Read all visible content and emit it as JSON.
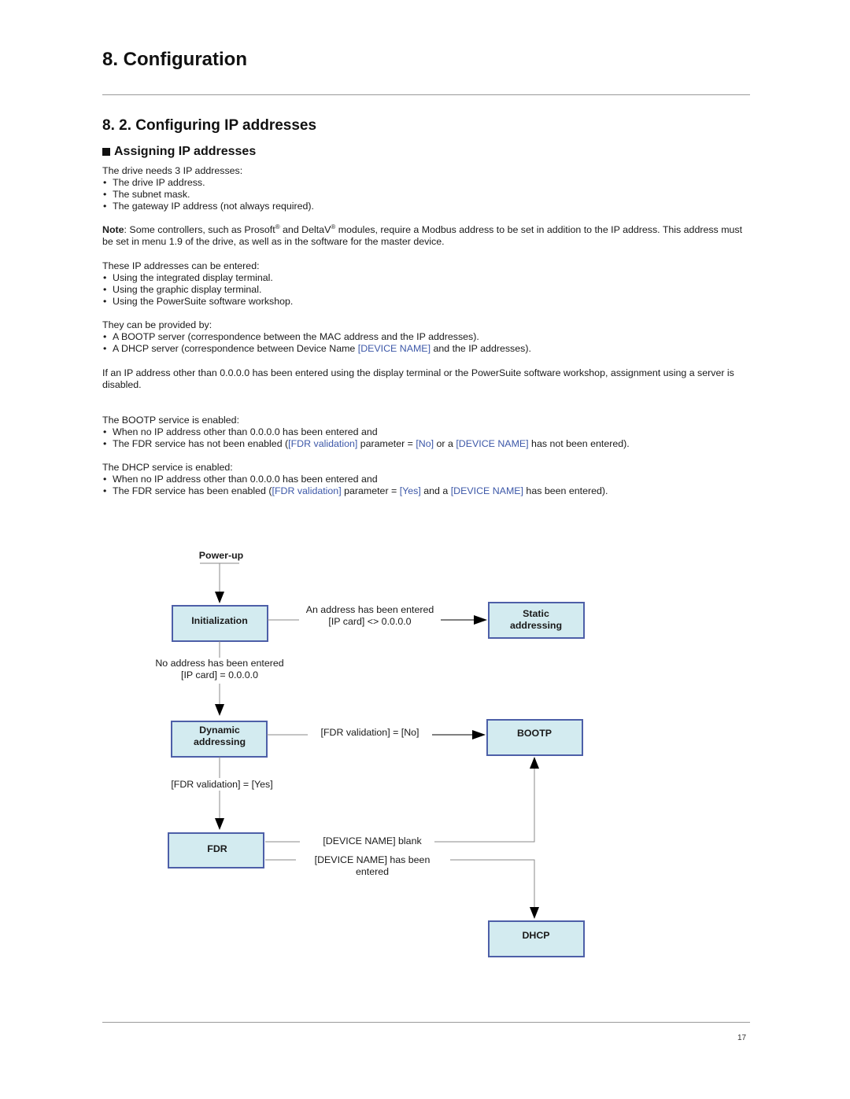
{
  "page": {
    "chapter_title": "8. Configuration",
    "section_title": "8. 2. Configuring IP addresses",
    "subsection_title": "Assigning IP addresses",
    "page_number": "17"
  },
  "intro": {
    "lead": "The drive needs 3 IP addresses:",
    "items": [
      "The drive IP address.",
      "The subnet mask.",
      "The gateway IP address (not always required)."
    ]
  },
  "note": {
    "label": "Note",
    "text_1": ": Some controllers, such as Prosoft",
    "reg": "®",
    "text_2": " and DeltaV",
    "text_3": " modules, require a Modbus address to be set in addition to the IP address. This address must be set in menu 1.9 of the drive, as well as in the software for the master device."
  },
  "entry": {
    "lead": "These IP addresses can be entered:",
    "items": [
      "Using the integrated display terminal.",
      "Using the graphic display terminal.",
      "Using the PowerSuite software workshop."
    ]
  },
  "provided": {
    "lead": "They can be provided by:",
    "item_1": "A BOOTP server (correspondence between the MAC address and the IP addresses).",
    "item_2_a": "A DHCP server (correspondence between Device Name ",
    "item_2_ref": "[DEVICE NAME]",
    "item_2_b": " and the IP addresses)."
  },
  "server_disabled": "If an IP address other than 0.0.0.0 has been entered using the display terminal or the PowerSuite software workshop, assignment using a server is disabled.",
  "bootp": {
    "lead": "The BOOTP service is enabled:",
    "item_1": "When no IP address other than 0.0.0.0 has been entered and",
    "item_2_a": "The FDR service has not been enabled (",
    "item_2_ref1": "[FDR validation]",
    "item_2_b": " parameter = ",
    "item_2_ref2": "[No]",
    "item_2_c": " or a ",
    "item_2_ref3": "[DEVICE NAME]",
    "item_2_d": " has not been entered)."
  },
  "dhcp": {
    "lead": "The DHCP service is enabled:",
    "item_1": "When no IP address other than 0.0.0.0 has been entered and",
    "item_2_a": "The FDR service has been enabled (",
    "item_2_ref1": "[FDR validation]",
    "item_2_b": " parameter = ",
    "item_2_ref2": "[Yes]",
    "item_2_c": " and a ",
    "item_2_ref3": "[DEVICE NAME]",
    "item_2_d": " has been entered)."
  },
  "diagram": {
    "colors": {
      "box_fill": "#d3ebf0",
      "box_border": "#4d5fa8",
      "line": "#8a8a8a",
      "arrow": "#000000",
      "link": "#3d58a8"
    },
    "start": "Power-up",
    "boxes": {
      "initialization": "Initialization",
      "static_1": "Static",
      "static_2": "addressing",
      "dynamic_1": "Dynamic",
      "dynamic_2": "addressing",
      "bootp": "BOOTP",
      "fdr": "FDR",
      "dhcp": "DHCP"
    },
    "labels": {
      "address_entered_1": "An address has been entered",
      "address_entered_2": "[IP card] <> 0.0.0.0",
      "no_address_1": "No address has been entered",
      "no_address_2": "[IP card] = 0.0.0.0",
      "fdr_no": "[FDR validation] = [No]",
      "fdr_yes": "[FDR validation] = [Yes]",
      "device_blank": "[DEVICE NAME] blank",
      "device_entered_1": "[DEVICE NAME] has been",
      "device_entered_2": "entered"
    }
  }
}
